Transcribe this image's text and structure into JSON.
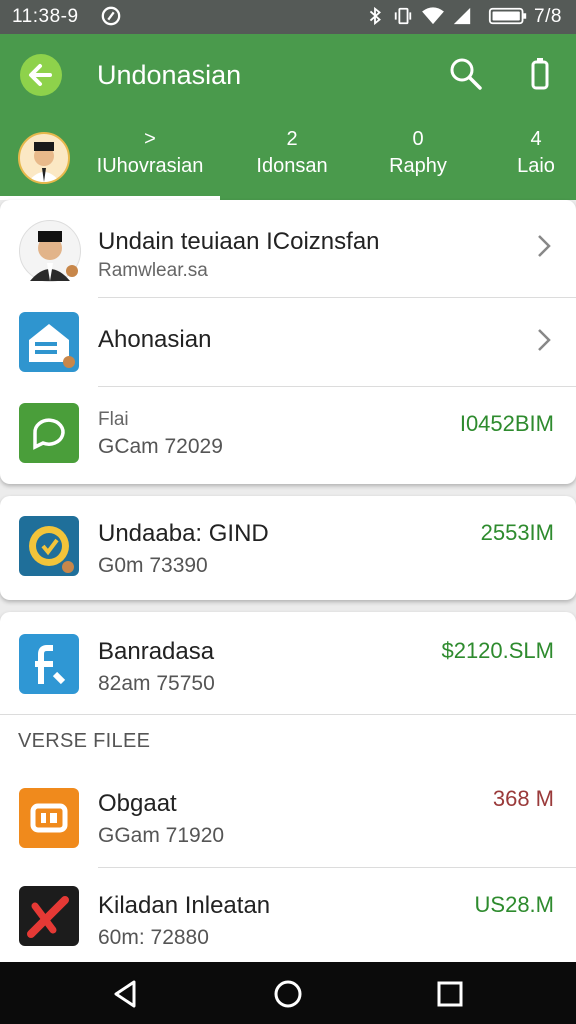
{
  "status_bar": {
    "time": "11:38-9",
    "right_text": "7/8"
  },
  "app_bar": {
    "title": "Undonasian"
  },
  "tabs": [
    {
      "count": ">",
      "label": "IUhovrasian"
    },
    {
      "count": "2",
      "label": "Idonsan"
    },
    {
      "count": "0",
      "label": "Raphy"
    },
    {
      "count": "4",
      "label": "Laio"
    }
  ],
  "card1": {
    "rows": [
      {
        "title": "Undain teuiaan ICoiznsfan",
        "subtitle": "Ramwlear.sa"
      },
      {
        "title": "Ahonasian",
        "subtitle": ""
      },
      {
        "title": "Flai",
        "subtitle": "GCam 72029",
        "amount": "I0452BIM"
      }
    ]
  },
  "card2": {
    "title": "Undaaba: GIND",
    "subtitle": "G0m 73390",
    "amount": "2553IM"
  },
  "card3": {
    "title": "Banradasa",
    "subtitle": "82am 75750",
    "amount": "$2120.SLM"
  },
  "section": {
    "header": "VERSE FILEE",
    "rows": [
      {
        "title": "Obgaat",
        "subtitle": "GGam 71920",
        "amount": "368 M"
      },
      {
        "title": "Kiladan Inleatan",
        "subtitle": "60m: 72880",
        "amount": "US28.M"
      }
    ]
  },
  "colors": {
    "app_bar": "#4a9a4c",
    "positive_amount": "#2e8b2e",
    "negative_amount": "#9a3a3a"
  }
}
